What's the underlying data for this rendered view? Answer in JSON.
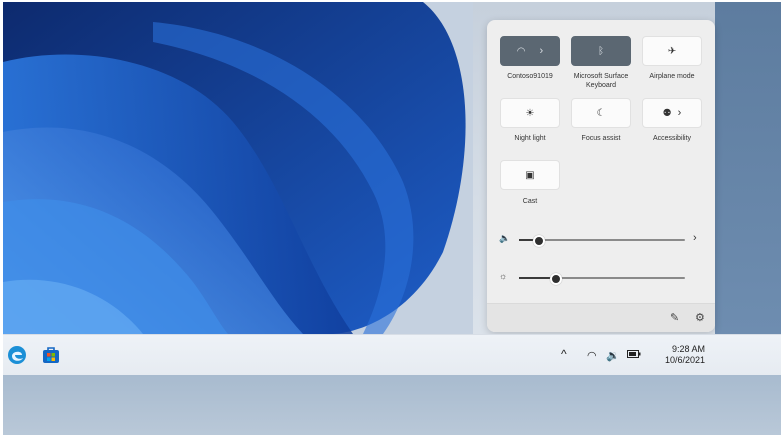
{
  "quick_settings": {
    "tiles": [
      {
        "label": "Contoso91019",
        "icon": "wifi-icon",
        "active": true,
        "has_chevron": true
      },
      {
        "label": "Microsoft Surface Keyboard",
        "icon": "bluetooth-icon",
        "active": true,
        "has_chevron": false
      },
      {
        "label": "Airplane mode",
        "icon": "airplane-icon",
        "active": false,
        "has_chevron": false
      },
      {
        "label": "Night light",
        "icon": "brightness-icon",
        "active": false,
        "has_chevron": false
      },
      {
        "label": "Focus assist",
        "icon": "moon-icon",
        "active": false,
        "has_chevron": false
      },
      {
        "label": "Accessibility",
        "icon": "accessibility-icon",
        "active": false,
        "has_chevron": true
      },
      {
        "label": "Cast",
        "icon": "cast-icon",
        "active": false,
        "has_chevron": false
      }
    ],
    "volume": {
      "icon": "speaker-icon",
      "level": 0.12
    },
    "brightness": {
      "icon": "sun-icon",
      "level": 0.22
    },
    "footer": {
      "edit_icon": "pencil-icon",
      "settings_icon": "gear-icon"
    }
  },
  "taskbar": {
    "apps": [
      {
        "name": "edge-icon",
        "color": "#1b8fd6"
      },
      {
        "name": "store-icon",
        "color": "#1467c4"
      }
    ],
    "tray": {
      "chevron": "^",
      "time": "9:28 AM",
      "date": "10/6/2021"
    }
  },
  "colors": {
    "tile_active": "#5b6772",
    "wallpaper_blue": "#1e5ec8"
  }
}
